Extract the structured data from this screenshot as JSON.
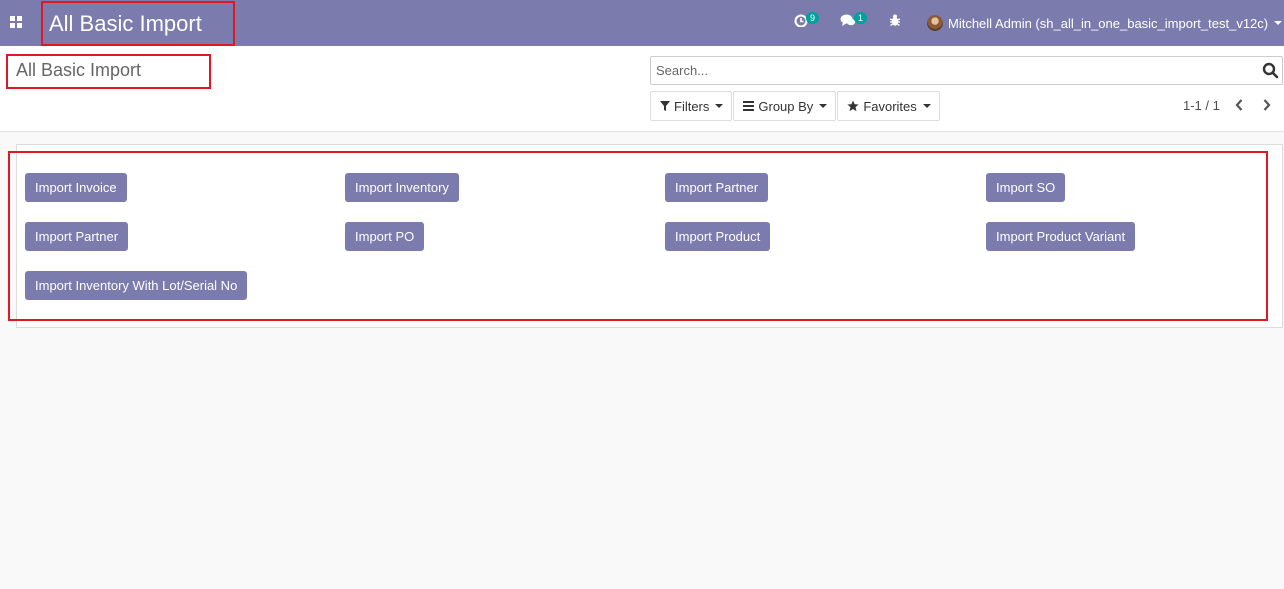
{
  "navbar": {
    "title": "All Basic Import",
    "activity_count": "9",
    "messages_count": "1",
    "user_name": "Mitchell Admin (sh_all_in_one_basic_import_test_v12c)"
  },
  "control_panel": {
    "breadcrumb": "All Basic Import",
    "search_placeholder": "Search...",
    "filters_label": "Filters",
    "group_by_label": "Group By",
    "favorites_label": "Favorites",
    "pager_value": "1-1 / 1"
  },
  "import_buttons": [
    "Import Invoice",
    "Import Inventory",
    "Import Partner",
    "Import SO",
    "Import Partner",
    "Import PO",
    "Import Product",
    "Import Product Variant",
    "Import Inventory With Lot/Serial No"
  ],
  "colors": {
    "brand": "#7c7bad",
    "badge": "#00a09d",
    "highlight": "#e0181f"
  }
}
